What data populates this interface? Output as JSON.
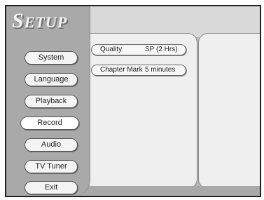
{
  "title": {
    "first": "S",
    "rest": "ETUP"
  },
  "menu": [
    {
      "label": "System",
      "selected": false
    },
    {
      "label": "Language",
      "selected": false
    },
    {
      "label": "Playback",
      "selected": false
    },
    {
      "label": "Record",
      "selected": true
    },
    {
      "label": "Audio",
      "selected": false
    },
    {
      "label": "TV Tuner",
      "selected": false
    },
    {
      "label": "Exit",
      "selected": false
    }
  ],
  "settings": [
    {
      "label": "Quality",
      "value": "SP (2 Hrs)"
    },
    {
      "label": "Chapter Mark",
      "value": "5 minutes"
    }
  ]
}
